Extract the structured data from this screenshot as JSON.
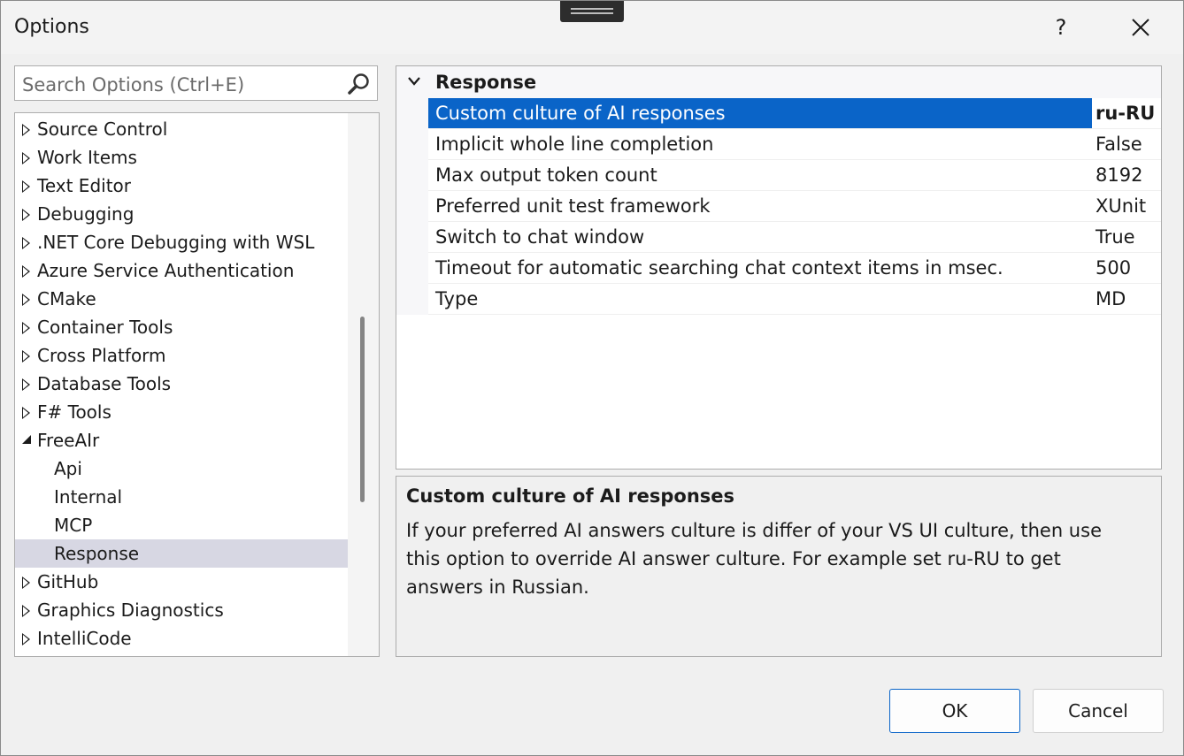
{
  "window": {
    "title": "Options",
    "help_label": "?",
    "close_label": "✕"
  },
  "search": {
    "placeholder": "Search Options (Ctrl+E)"
  },
  "tree": {
    "items": [
      {
        "label": "Source Control",
        "expander": "collapsed",
        "level": 0
      },
      {
        "label": "Work Items",
        "expander": "collapsed",
        "level": 0
      },
      {
        "label": "Text Editor",
        "expander": "collapsed",
        "level": 0
      },
      {
        "label": "Debugging",
        "expander": "collapsed",
        "level": 0
      },
      {
        "label": ".NET Core Debugging with WSL",
        "expander": "collapsed",
        "level": 0
      },
      {
        "label": "Azure Service Authentication",
        "expander": "collapsed",
        "level": 0
      },
      {
        "label": "CMake",
        "expander": "collapsed",
        "level": 0
      },
      {
        "label": "Container Tools",
        "expander": "collapsed",
        "level": 0
      },
      {
        "label": "Cross Platform",
        "expander": "collapsed",
        "level": 0
      },
      {
        "label": "Database Tools",
        "expander": "collapsed",
        "level": 0
      },
      {
        "label": "F# Tools",
        "expander": "collapsed",
        "level": 0
      },
      {
        "label": "FreeAIr",
        "expander": "expanded",
        "level": 0
      },
      {
        "label": "Api",
        "expander": "none",
        "level": 1
      },
      {
        "label": "Internal",
        "expander": "none",
        "level": 1
      },
      {
        "label": "MCP",
        "expander": "none",
        "level": 1
      },
      {
        "label": "Response",
        "expander": "none",
        "level": 1,
        "selected": true
      },
      {
        "label": "GitHub",
        "expander": "collapsed",
        "level": 0
      },
      {
        "label": "Graphics Diagnostics",
        "expander": "collapsed",
        "level": 0
      },
      {
        "label": "IntelliCode",
        "expander": "collapsed",
        "level": 0
      }
    ]
  },
  "grid": {
    "category": "Response",
    "properties": [
      {
        "name": "Custom culture of AI responses",
        "value": "ru-RU",
        "selected": true
      },
      {
        "name": "Implicit whole line completion",
        "value": "False"
      },
      {
        "name": "Max output token count",
        "value": "8192"
      },
      {
        "name": "Preferred unit test framework",
        "value": "XUnit"
      },
      {
        "name": "Switch to chat window",
        "value": "True"
      },
      {
        "name": "Timeout for automatic searching chat context items in msec.",
        "value": "500"
      },
      {
        "name": "Type",
        "value": "MD"
      }
    ]
  },
  "description": {
    "title": "Custom culture of AI responses",
    "text": "If your preferred AI answers culture is differ of your VS UI culture, then use this option to override AI answer culture. For example set ru-RU to get answers in Russian."
  },
  "buttons": {
    "ok": "OK",
    "cancel": "Cancel"
  },
  "colors": {
    "selection_blue": "#0a64c8",
    "tree_selection": "#d7d7e3"
  }
}
